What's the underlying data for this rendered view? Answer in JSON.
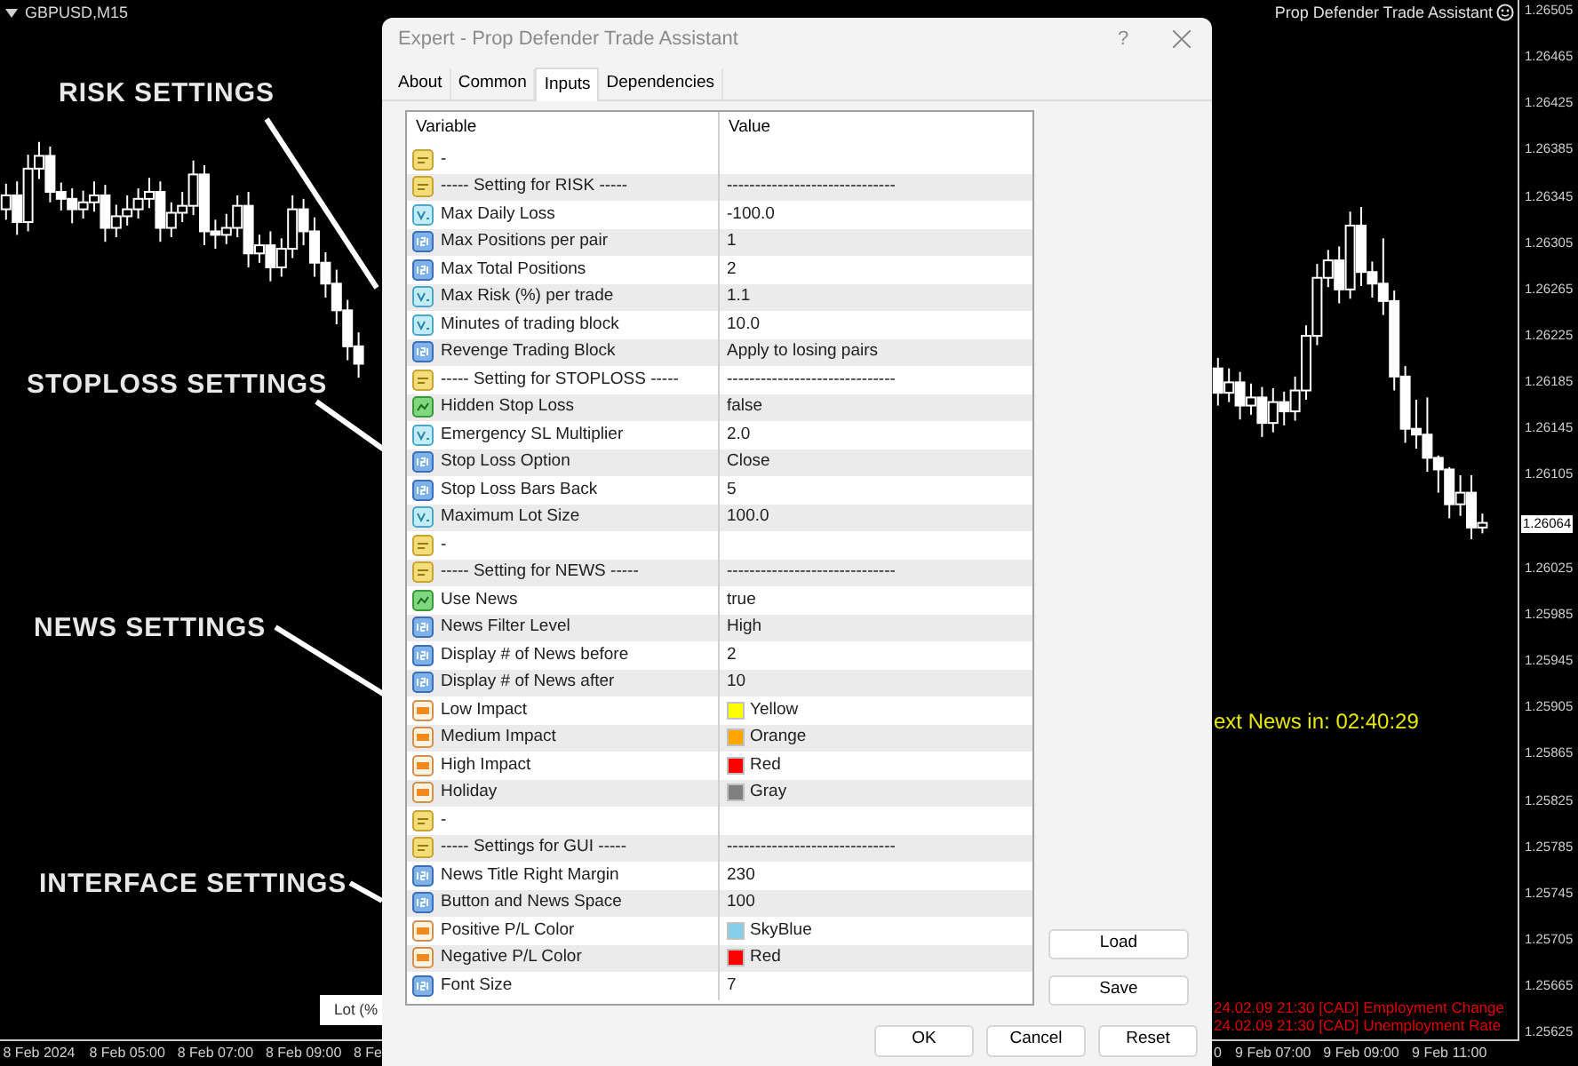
{
  "chart": {
    "symbol": "GBPUSD,M15",
    "indicator_title": "Prop Defender Trade Assistant",
    "chart_data": {
      "type": "candlestick",
      "categories": [
        null,
        null,
        null,
        "8 Feb 2024",
        null,
        null,
        null,
        null,
        null,
        null,
        null,
        "8 Feb 05:00",
        null,
        null,
        null,
        null,
        null,
        null,
        null,
        "8 Feb 07:00",
        null,
        null,
        null,
        null,
        null,
        null,
        null,
        "8 Feb 09:00",
        null,
        null,
        null,
        null,
        null,
        null,
        null,
        null,
        null,
        null,
        null,
        null,
        null,
        null,
        null,
        null,
        null,
        null,
        null,
        null,
        null,
        null,
        null,
        null,
        null,
        null,
        null,
        null,
        null,
        null,
        null,
        null,
        null,
        null,
        null,
        null,
        null,
        null,
        null,
        null,
        null,
        null,
        null,
        null,
        null,
        null,
        null,
        null,
        null,
        null,
        null,
        null,
        null,
        null,
        null,
        null,
        null,
        null,
        null,
        null,
        null,
        null,
        null,
        null,
        null,
        null,
        null,
        null,
        null,
        null,
        null,
        null,
        null,
        null,
        null,
        null,
        null,
        null,
        null,
        null,
        null,
        null,
        null,
        null,
        null,
        null,
        null,
        "9 Feb 07:00",
        null,
        null,
        null,
        null,
        null,
        null,
        null,
        "9 Feb 09:00",
        null,
        null,
        null,
        null,
        null,
        null,
        null,
        "9 Feb 11:00",
        null,
        null,
        null
      ],
      "ylim": [
        1.256193,
        1.265142
      ],
      "ohlc": [
        [
          1.26334,
          1.26356,
          1.26325,
          1.26346
        ],
        [
          1.26346,
          1.26358,
          1.26312,
          1.26323
        ],
        [
          1.26323,
          1.26381,
          1.26315,
          1.26369
        ],
        [
          1.26369,
          1.26392,
          1.2636,
          1.2638
        ],
        [
          1.2638,
          1.26388,
          1.2634,
          1.26349
        ],
        [
          1.26349,
          1.26357,
          1.26333,
          1.26343
        ],
        [
          1.26343,
          1.26352,
          1.26322,
          1.26334
        ],
        [
          1.26334,
          1.2635,
          1.26326,
          1.2634
        ],
        [
          1.2634,
          1.26358,
          1.26332,
          1.26346
        ],
        [
          1.26346,
          1.26355,
          1.26306,
          1.26318
        ],
        [
          1.26318,
          1.26338,
          1.2631,
          1.26328
        ],
        [
          1.26328,
          1.26346,
          1.2632,
          1.26334
        ],
        [
          1.26334,
          1.26352,
          1.26326,
          1.26343
        ],
        [
          1.26343,
          1.26361,
          1.26335,
          1.26349
        ],
        [
          1.26349,
          1.26358,
          1.26306,
          1.26318
        ],
        [
          1.26318,
          1.2634,
          1.2631,
          1.26331
        ],
        [
          1.26331,
          1.26349,
          1.26323,
          1.26337
        ],
        [
          1.26337,
          1.26376,
          1.26329,
          1.26364
        ],
        [
          1.26364,
          1.26372,
          1.26303,
          1.26315
        ],
        [
          1.26315,
          1.26325,
          1.263,
          1.26312
        ],
        [
          1.26312,
          1.2633,
          1.26304,
          1.26318
        ],
        [
          1.26318,
          1.26346,
          1.2631,
          1.26337
        ],
        [
          1.26337,
          1.26349,
          1.26284,
          1.26296
        ],
        [
          1.26296,
          1.26312,
          1.26288,
          1.26303
        ],
        [
          1.26303,
          1.26315,
          1.26272,
          1.26284
        ],
        [
          1.26284,
          1.26309,
          1.26276,
          1.263
        ],
        [
          1.263,
          1.26346,
          1.26292,
          1.26334
        ],
        [
          1.26334,
          1.26343,
          1.26303,
          1.26315
        ],
        [
          1.26315,
          1.26327,
          1.26276,
          1.26288
        ],
        [
          1.26288,
          1.26297,
          1.26258,
          1.2627
        ],
        [
          1.2627,
          1.26282,
          1.26235,
          1.26247
        ],
        [
          1.26247,
          1.26256,
          1.26204,
          1.26216
        ],
        [
          1.26216,
          1.26228,
          1.26189,
          1.26201
        ],
        null,
        null,
        null,
        null,
        null,
        null,
        null,
        null,
        null,
        null,
        null,
        null,
        null,
        null,
        null,
        null,
        null,
        null,
        null,
        null,
        null,
        null,
        null,
        null,
        null,
        null,
        null,
        null,
        null,
        null,
        null,
        null,
        null,
        null,
        null,
        null,
        null,
        null,
        null,
        null,
        null,
        null,
        null,
        null,
        null,
        null,
        null,
        null,
        null,
        null,
        null,
        null,
        null,
        null,
        null,
        null,
        null,
        null,
        null,
        null,
        null,
        null,
        null,
        null,
        null,
        null,
        null,
        null,
        null,
        null,
        null,
        null,
        null,
        null,
        null,
        null,
        null,
        [
          1.26197,
          1.26206,
          1.26165,
          1.26176
        ],
        [
          1.26176,
          1.26197,
          1.26168,
          1.26185
        ],
        [
          1.26185,
          1.26194,
          1.26153,
          1.26165
        ],
        [
          1.26165,
          1.26184,
          1.26157,
          1.26172
        ],
        [
          1.26172,
          1.26181,
          1.26138,
          1.2615
        ],
        [
          1.2615,
          1.2618,
          1.26142,
          1.26168
        ],
        [
          1.26168,
          1.26177,
          1.26148,
          1.2616
        ],
        [
          1.2616,
          1.2619,
          1.26152,
          1.26178
        ],
        [
          1.26178,
          1.26234,
          1.2617,
          1.26225
        ],
        [
          1.26225,
          1.26287,
          1.26217,
          1.26275
        ],
        [
          1.26275,
          1.26299,
          1.26267,
          1.2629
        ],
        [
          1.2629,
          1.26302,
          1.26253,
          1.26265
        ],
        [
          1.26265,
          1.26332,
          1.26257,
          1.2632
        ],
        [
          1.2632,
          1.26336,
          1.26268,
          1.2628
        ],
        [
          1.2628,
          1.26289,
          1.26258,
          1.2627
        ],
        [
          1.2627,
          1.26309,
          1.26243,
          1.26255
        ],
        [
          1.26255,
          1.26264,
          1.26178,
          1.2619
        ],
        [
          1.2619,
          1.26199,
          1.26133,
          1.26145
        ],
        [
          1.26145,
          1.2617,
          1.26128,
          1.2614
        ],
        [
          1.2614,
          1.26172,
          1.26108,
          1.2612
        ],
        [
          1.2612,
          1.26122,
          1.2609,
          1.2611
        ],
        [
          1.2611,
          1.26112,
          1.26068,
          1.2608
        ],
        [
          1.2608,
          1.26105,
          1.2607,
          1.2609
        ],
        [
          1.2609,
          1.26105,
          1.2605,
          1.2606
        ],
        [
          1.2606,
          1.26072,
          1.26055,
          1.26064
        ]
      ],
      "yticks": [
        {
          "value": 1.26505,
          "label": "1.26505"
        },
        {
          "value": 1.26465,
          "label": "1.26465"
        },
        {
          "value": 1.26425,
          "label": "1.26425"
        },
        {
          "value": 1.26385,
          "label": "1.26385"
        },
        {
          "value": 1.26345,
          "label": "1.26345"
        },
        {
          "value": 1.26305,
          "label": "1.26305"
        },
        {
          "value": 1.26265,
          "label": "1.26265"
        },
        {
          "value": 1.26225,
          "label": "1.26225"
        },
        {
          "value": 1.26185,
          "label": "1.26185"
        },
        {
          "value": 1.26145,
          "label": "1.26145"
        },
        {
          "value": 1.26105,
          "label": "1.26105"
        },
        {
          "value": 1.26025,
          "label": "1.26025"
        },
        {
          "value": 1.25985,
          "label": "1.25985"
        },
        {
          "value": 1.25945,
          "label": "1.25945"
        },
        {
          "value": 1.25905,
          "label": "1.25905"
        },
        {
          "value": 1.25865,
          "label": "1.25865"
        },
        {
          "value": 1.25825,
          "label": "1.25825"
        },
        {
          "value": 1.25785,
          "label": "1.25785"
        },
        {
          "value": 1.25745,
          "label": "1.25745"
        },
        {
          "value": 1.25705,
          "label": "1.25705"
        },
        {
          "value": 1.25665,
          "label": "1.25665"
        },
        {
          "value": 1.25625,
          "label": "1.25625"
        }
      ]
    },
    "current_price": "1.26064",
    "time_axis_fragments": [
      "8 Fe",
      "0"
    ],
    "countdown": "ext News in: 02:40:29",
    "news_lines": [
      "24.02.09 21:30 [CAD] Employment Change",
      "24.02.09 21:30 [CAD] Unemployment Rate"
    ],
    "lot_button": "Lot (%"
  },
  "annotations": [
    {
      "label": "RISK SETTINGS"
    },
    {
      "label": "STOPLOSS SETTINGS"
    },
    {
      "label": "NEWS SETTINGS"
    },
    {
      "label": "INTERFACE SETTINGS"
    }
  ],
  "dialog": {
    "title": "Expert - Prop Defender Trade Assistant",
    "help": "?",
    "tabs": [
      {
        "label": "About",
        "selected": false
      },
      {
        "label": "Common",
        "selected": false
      },
      {
        "label": "Inputs",
        "selected": true
      },
      {
        "label": "Dependencies",
        "selected": false
      }
    ],
    "columns": [
      "Variable",
      "Value"
    ],
    "rows": [
      {
        "kind": "string",
        "variable": "-"
      },
      {
        "kind": "string",
        "variable": "----- Setting for RISK -----",
        "value": "------------------------------"
      },
      {
        "kind": "double",
        "variable": "Max Daily Loss",
        "value": "-100.0"
      },
      {
        "kind": "integer",
        "variable": "Max Positions per pair",
        "value": "1"
      },
      {
        "kind": "integer",
        "variable": "Max Total Positions",
        "value": "2"
      },
      {
        "kind": "double",
        "variable": "Max Risk (%) per trade",
        "value": "1.1"
      },
      {
        "kind": "double",
        "variable": "Minutes of trading block",
        "value": "10.0"
      },
      {
        "kind": "integer",
        "variable": "Revenge Trading Block",
        "value": "Apply to losing pairs"
      },
      {
        "kind": "string",
        "variable": "----- Setting for STOPLOSS -----",
        "value": "------------------------------"
      },
      {
        "kind": "boolean",
        "variable": "Hidden Stop Loss",
        "value": "false"
      },
      {
        "kind": "double",
        "variable": "Emergency SL Multiplier",
        "value": "2.0"
      },
      {
        "kind": "integer",
        "variable": "Stop Loss Option",
        "value": "Close"
      },
      {
        "kind": "integer",
        "variable": "Stop Loss Bars Back",
        "value": "5"
      },
      {
        "kind": "double",
        "variable": "Maximum Lot Size",
        "value": "100.0"
      },
      {
        "kind": "string",
        "variable": "-"
      },
      {
        "kind": "string",
        "variable": "----- Setting for NEWS -----",
        "value": "------------------------------"
      },
      {
        "kind": "boolean",
        "variable": "Use News",
        "value": "true"
      },
      {
        "kind": "integer",
        "variable": "News Filter Level",
        "value": "High"
      },
      {
        "kind": "integer",
        "variable": "Display # of News before",
        "value": "2"
      },
      {
        "kind": "integer",
        "variable": "Display # of News after",
        "value": "10"
      },
      {
        "kind": "color",
        "variable": "Low Impact",
        "value": "Yellow",
        "color": "#ffff00"
      },
      {
        "kind": "color",
        "variable": "Medium Impact",
        "value": "Orange",
        "color": "#ffa500"
      },
      {
        "kind": "color",
        "variable": "High Impact",
        "value": "Red",
        "color": "#ff0000"
      },
      {
        "kind": "color",
        "variable": "Holiday",
        "value": "Gray",
        "color": "#808080"
      },
      {
        "kind": "string",
        "variable": "-"
      },
      {
        "kind": "string",
        "variable": "----- Settings for GUI -----",
        "value": "------------------------------"
      },
      {
        "kind": "integer",
        "variable": "News Title Right Margin",
        "value": "230"
      },
      {
        "kind": "integer",
        "variable": "Button and News Space",
        "value": "100"
      },
      {
        "kind": "color",
        "variable": "Positive P/L Color",
        "value": "SkyBlue",
        "color": "#87ceeb"
      },
      {
        "kind": "color",
        "variable": "Negative P/L Color",
        "value": "Red",
        "color": "#ff0000"
      },
      {
        "kind": "integer",
        "variable": "Font Size",
        "value": "7"
      }
    ],
    "side_buttons": [
      "Load",
      "Save"
    ],
    "buttons": [
      "OK",
      "Cancel",
      "Reset"
    ]
  }
}
